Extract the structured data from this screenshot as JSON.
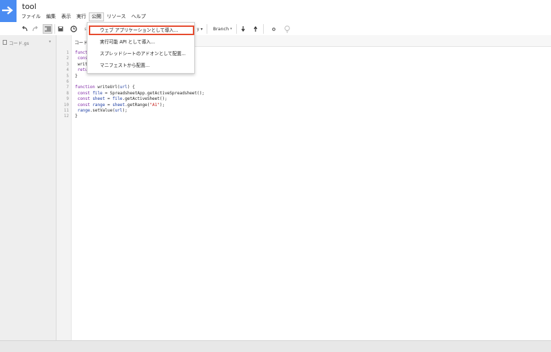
{
  "app": {
    "title": "tool"
  },
  "menus": [
    "ファイル",
    "編集",
    "表示",
    "実行",
    "公開",
    "リソース",
    "ヘルプ"
  ],
  "active_menu": "公開",
  "toolbar": {
    "branch_label": "Branch",
    "partial_label": "y"
  },
  "file_panel": {
    "file_name": "コード.gs"
  },
  "editor": {
    "tab_label": "コード.",
    "line_numbers": [
      "1",
      "2",
      "3",
      "4",
      "5",
      "6",
      "7",
      "8",
      "9",
      "10",
      "11",
      "12"
    ]
  },
  "dropdown": {
    "items": [
      "ウェブ アプリケーションとして導入...",
      "実行可能 API として導入...",
      "スプレッドシートのアドオンとして配置...",
      "マニフェストから配置..."
    ]
  },
  "colors": {
    "accent": "#4a8cf2",
    "highlight": "#e64a2e"
  }
}
